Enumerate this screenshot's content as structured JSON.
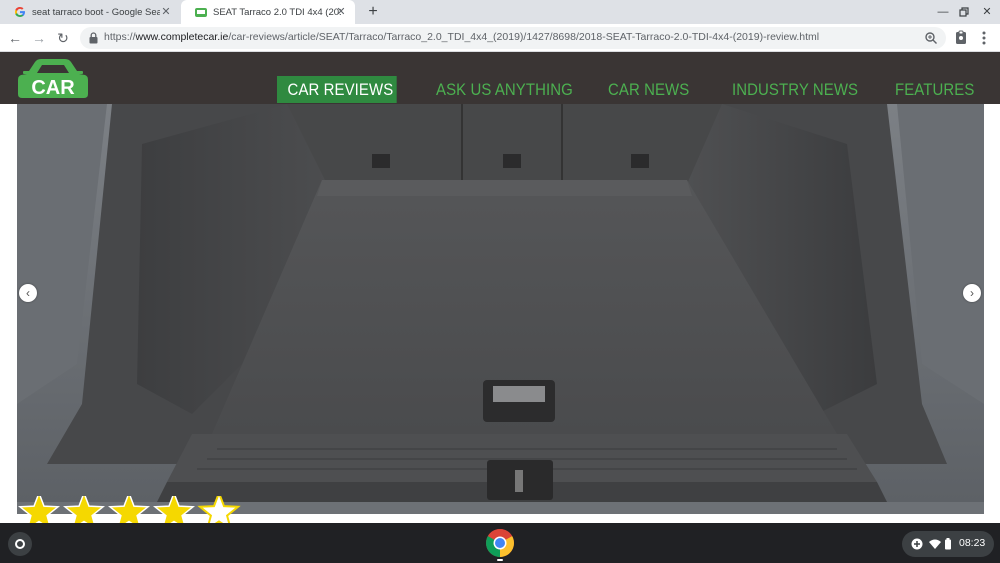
{
  "browser": {
    "tabs": [
      {
        "title": "seat tarraco boot - Google Search",
        "favicon": "google-icon",
        "active": false
      },
      {
        "title": "SEAT Tarraco 2.0 TDI 4x4 (2019) review",
        "favicon": "completecar-icon",
        "active": true
      }
    ],
    "url_scheme": "https://",
    "url_host": "www.completecar.ie",
    "url_path": "/car-reviews/article/SEAT/Tarraco/Tarraco_2.0_TDI_4x4_(2019)/1427/8698/2018-SEAT-Tarraco-2.0-TDI-4x4-(2019)-review.html"
  },
  "site": {
    "logo_text": "CAR",
    "nav": [
      {
        "label": "CAR REVIEWS",
        "active": true
      },
      {
        "label": "ASK US ANYTHING",
        "active": false
      },
      {
        "label": "CAR NEWS",
        "active": false
      },
      {
        "label": "INDUSTRY NEWS",
        "active": false
      },
      {
        "label": "FEATURES",
        "active": false
      }
    ],
    "colors": {
      "header_bg": "#3a3534",
      "nav_green": "#4cb050",
      "active_bg": "#2f8a40",
      "star": "#f5d800"
    }
  },
  "review": {
    "rating": 4,
    "rating_max": 5,
    "image": "seat-tarraco-boot-photo"
  },
  "shelf": {
    "time": "08:23",
    "apps": [
      "chrome-icon"
    ]
  }
}
